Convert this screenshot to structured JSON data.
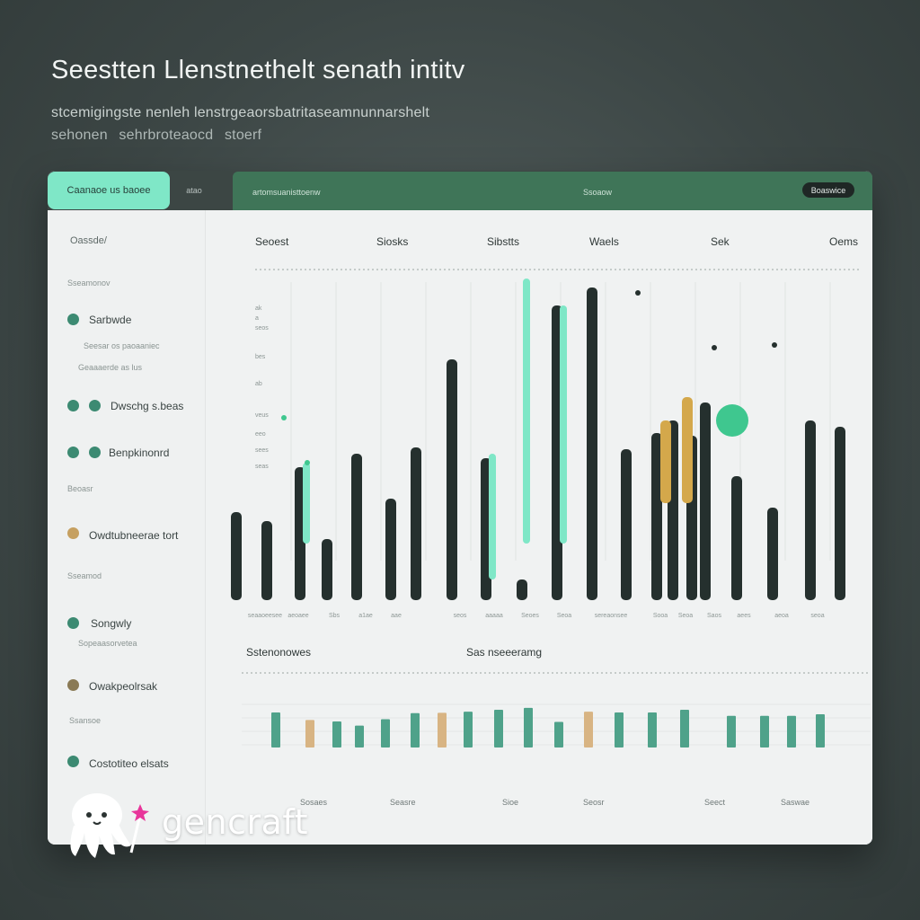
{
  "page": {
    "heading": "Seestten Llenstnethelt senath intitv",
    "subtitle_1": "stcemigingste nenleh lenstrgeaorsbatritaseamnunnarshelt",
    "subtitle_2": "sehonen   sehrbroteaocd   stoerf"
  },
  "window": {
    "tab_active": "Caanaoe us baoee",
    "tab_small": "atao",
    "bar_left": "artomsuanisttoenw",
    "bar_mid": "Ssoaow",
    "bar_button": "Boaswice",
    "accent": "#7fe7c7",
    "bar_color": "#3f7558"
  },
  "sidebar": {
    "section_1": "Oassde/",
    "section_2": "Sseamonov",
    "items": [
      {
        "label": "Sarbwde",
        "color": "#3c8a72",
        "sub_1": "Seesar os paoaaniec",
        "sub_2": "Geaaaerde as lus"
      },
      {
        "label": "Dwschg s.beas",
        "color": "#3c8a72"
      },
      {
        "label": "Benpkinonrd",
        "color": "#3c8a72"
      },
      {
        "label": "Owdtubneerae tort",
        "color": "#c6a060"
      },
      {
        "label": "Songwly",
        "color": "#3c8a72",
        "sub_1": "Sopeaasorvetea"
      },
      {
        "label": "Owakpeolrsak",
        "color": "#8a7a55"
      },
      {
        "label": "Costotiteo elsats",
        "color": "#3c8a72"
      }
    ],
    "section_3": "Beoasr",
    "section_4": "Sseamod",
    "section_5": "Ssansoe"
  },
  "main": {
    "col_headers": [
      "Seoest",
      "Siosks",
      "Sibstts",
      "Waels",
      "Sek",
      "Oems"
    ],
    "y_labels": [
      "ak",
      "a",
      "seos",
      "bes",
      "ab",
      "veus",
      "eeo",
      "sees",
      "seas"
    ],
    "lower_title_1": "Sstenonowes",
    "lower_title_2": "Sas nseeeramg",
    "footer_labels": [
      "Sosaes",
      "Seasre",
      "Sioe",
      "Seosr",
      "Seect",
      "Saswae"
    ]
  },
  "chart_data": [
    {
      "type": "bar",
      "title": "",
      "grid": true,
      "legend": "none",
      "bar_tops": [
        570,
        580,
        520,
        600,
        505,
        555,
        498,
        400,
        510,
        645,
        340,
        320,
        500,
        482,
        468,
        485,
        448,
        530,
        565,
        468,
        475,
        318
      ],
      "accent_tops": [
        515,
        500,
        340,
        445,
        440
      ],
      "colors": {
        "dark": "#25302e",
        "green": "#7fe7c7",
        "orange": "#d4a84b"
      },
      "x_labels": [
        "seaaoeesee",
        "aeoaee",
        "Sbs",
        "a1ae",
        "aae",
        "seos",
        "aaaaa",
        "Seoes",
        "Seoa",
        "sereaonsee",
        "Sooa",
        "Seoa",
        "Saos",
        "aees",
        "aeoa",
        "seoa"
      ]
    },
    {
      "type": "bar",
      "title": "",
      "grid": true,
      "legend": "none",
      "values": [
        0.93,
        0.73,
        0.69,
        0.58,
        0.75,
        0.91,
        0.92,
        0.95,
        1.0,
        1.05,
        0.68,
        0.95,
        0.93,
        0.93,
        1.0,
        0.84,
        0.84,
        0.84,
        0.88
      ],
      "colors": [
        "#4fa28a",
        "#d8b483",
        "#4fa28a",
        "#4fa28a",
        "#4fa28a",
        "#4fa28a",
        "#d8b483",
        "#4fa28a",
        "#4fa28a",
        "#4fa28a",
        "#4fa28a",
        "#d8b483",
        "#4fa28a",
        "#4fa28a",
        "#4fa28a",
        "#4fa28a",
        "#4fa28a",
        "#4fa28a",
        "#4fa28a"
      ]
    }
  ],
  "branding": {
    "logo_text": "gencraft"
  }
}
